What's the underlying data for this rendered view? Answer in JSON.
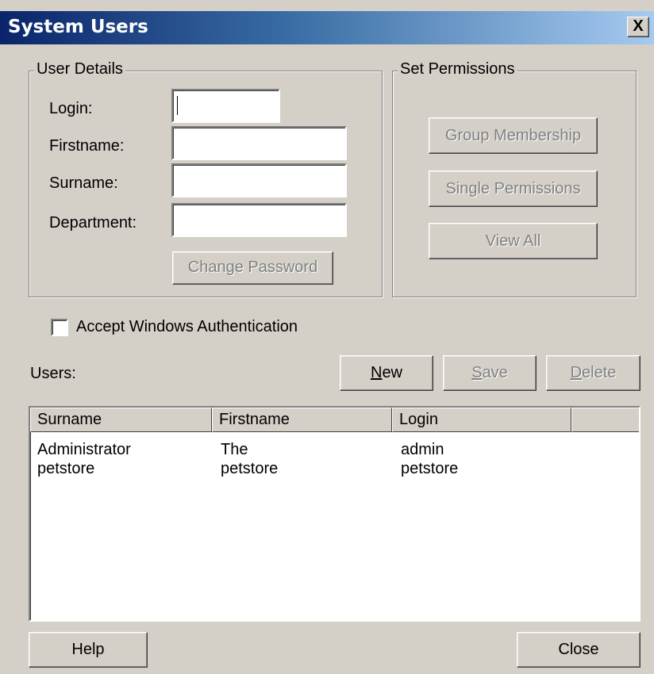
{
  "window": {
    "title": "System Users",
    "close_label": "X"
  },
  "user_details": {
    "legend": "User Details",
    "login_label": "Login:",
    "firstname_label": "Firstname:",
    "surname_label": "Surname:",
    "department_label": "Department:",
    "login_value": "",
    "firstname_value": "",
    "surname_value": "",
    "department_value": "",
    "change_password_label": "Change Password"
  },
  "permissions": {
    "legend": "Set Permissions",
    "group_membership_label": "Group Membership",
    "single_permissions_label": "Single Permissions",
    "view_all_label": "View All"
  },
  "auth": {
    "checkbox_label": "Accept Windows Authentication",
    "checked": false
  },
  "users": {
    "label": "Users:",
    "new_label_mnemonic": "N",
    "new_label_rest": "ew",
    "save_label_mnemonic": "S",
    "save_label_rest": "ave",
    "delete_label_mnemonic": "D",
    "delete_label_rest": "elete",
    "columns": [
      "Surname",
      "Firstname",
      "Login"
    ],
    "rows": [
      [
        "Administrator",
        "The",
        "admin"
      ],
      [
        "petstore",
        "petstore",
        "petstore"
      ]
    ]
  },
  "footer": {
    "help_label": "Help",
    "close_label": "Close"
  }
}
